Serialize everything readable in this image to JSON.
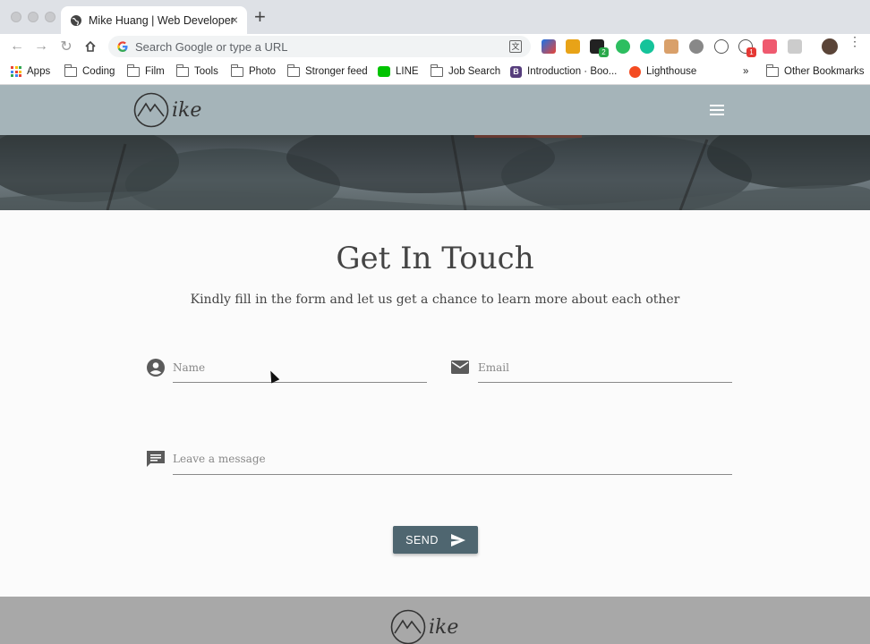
{
  "browser": {
    "tab_title": "Mike Huang | Web Developer",
    "new_tab_symbol": "+",
    "omnibox_placeholder": "Search Google or type a URL",
    "extension_badges": [
      "2",
      "1"
    ],
    "bookmarks": [
      {
        "label": "Apps",
        "icon": "apps-grid-icon"
      },
      {
        "label": "Coding",
        "icon": "folder-icon"
      },
      {
        "label": "Film",
        "icon": "folder-icon"
      },
      {
        "label": "Tools",
        "icon": "folder-icon"
      },
      {
        "label": "Photo",
        "icon": "folder-icon"
      },
      {
        "label": "Stronger feed",
        "icon": "folder-icon"
      },
      {
        "label": "LINE",
        "icon": "line-app-icon"
      },
      {
        "label": "Job Search",
        "icon": "folder-icon"
      },
      {
        "label": "Introduction · Boo...",
        "icon": "bootstrap-icon"
      },
      {
        "label": "Lighthouse",
        "icon": "lighthouse-icon"
      }
    ],
    "more_bookmarks": "»",
    "other_bookmarks": "Other Bookmarks"
  },
  "site": {
    "logo_text": "ike",
    "contact": {
      "heading": "Get In Touch",
      "subheading": "Kindly fill in the form and let us get a chance to learn more about each other",
      "name_placeholder": "Name",
      "email_placeholder": "Email",
      "message_placeholder": "Leave a message",
      "send_label": "SEND"
    },
    "footer_logo_text": "ike"
  },
  "colors": {
    "navbar": "#a5b4b9",
    "send_button": "#4f6670",
    "footer": "#a8a8a8"
  }
}
